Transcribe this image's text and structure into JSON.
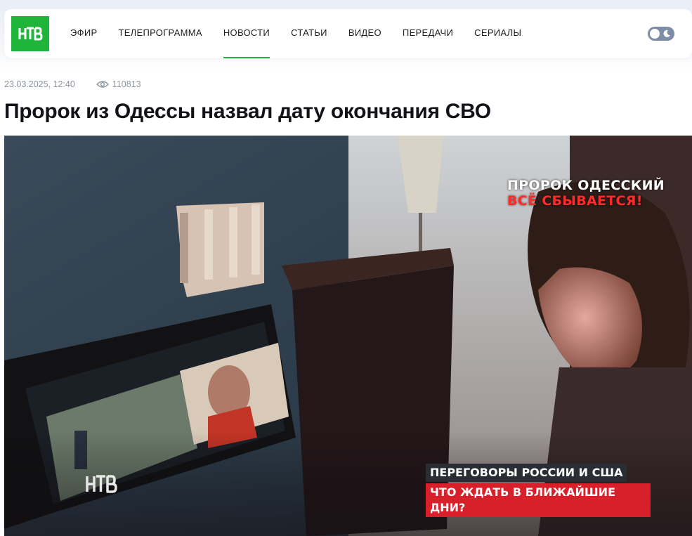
{
  "header": {
    "logo_text": "НТВ",
    "nav": [
      {
        "label": "ЭФИР"
      },
      {
        "label": "ТЕЛЕПРОГРАММА"
      },
      {
        "label": "НОВОСТИ"
      },
      {
        "label": "СТАТЬИ"
      },
      {
        "label": "ВИДЕО"
      },
      {
        "label": "ПЕРЕДАЧИ"
      },
      {
        "label": "СЕРИАЛЫ"
      }
    ],
    "active_nav": "НОВОСТИ",
    "theme_icon": "moon-icon"
  },
  "article": {
    "date": "23.03.2025, 12:40",
    "views": "110813",
    "title": "Пророк из Одессы назвал дату окончания СВО"
  },
  "hero": {
    "caption_top_line1": "ПРОРОК ОДЕССКИЙ",
    "caption_top_line2": "ВСЁ СБЫВАЕТСЯ!",
    "caption_bottom_line1": "ПЕРЕГОВОРЫ РОССИИ И США",
    "caption_bottom_line2": "ЧТО ЖДАТЬ В БЛИЖАЙШИЕ ДНИ?",
    "watermark": "НТВ"
  },
  "colors": {
    "brand_green": "#1fb53a",
    "accent_red": "#d8202a",
    "meta_gray": "#8c95a3"
  }
}
